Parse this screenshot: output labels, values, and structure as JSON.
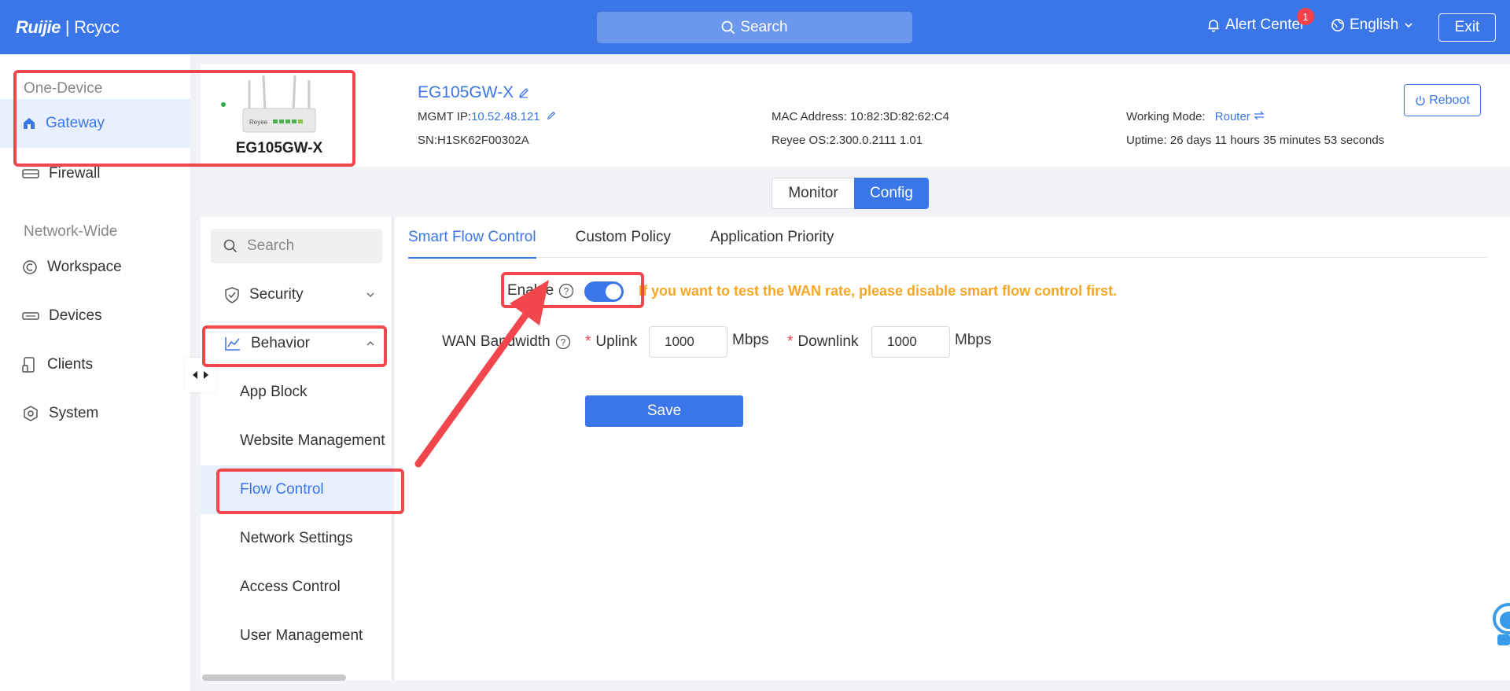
{
  "topbar": {
    "logo_a": "Ruijie",
    "logo_sep": "|",
    "logo_b": "Rcycc",
    "search_label": "Search",
    "alert_label": "Alert Center",
    "alert_count": "1",
    "language": "English",
    "exit_label": "Exit",
    "brand_color": "#3a76e8"
  },
  "sidebar": {
    "one_device_heading": "One-Device",
    "network_wide_heading": "Network-Wide",
    "items": [
      {
        "label": "Gateway",
        "icon": "home-icon",
        "active": true
      },
      {
        "label": "Firewall",
        "icon": "firewall-icon"
      },
      {
        "label": "Workspace",
        "icon": "workspace-icon"
      },
      {
        "label": "Devices",
        "icon": "devices-icon"
      },
      {
        "label": "Clients",
        "icon": "clients-icon"
      },
      {
        "label": "System",
        "icon": "system-icon"
      }
    ]
  },
  "device": {
    "image_caption": "EG105GW-X",
    "image_brand": "Reyee",
    "name": "EG105GW-X",
    "mgmt_ip_label": "MGMT IP:",
    "mgmt_ip": "10.52.48.121",
    "sn": "SN:H1SK62F00302A",
    "mac": "MAC Address: 10:82:3D:82:62:C4",
    "os": "Reyee OS:2.300.0.2111 1.01",
    "working_mode_label": "Working Mode:",
    "working_mode": "Router",
    "uptime": "Uptime: 26 days 11 hours 35 minutes 53 seconds",
    "reboot_label": "Reboot"
  },
  "mode_switch": {
    "monitor": "Monitor",
    "config": "Config",
    "active": "Config"
  },
  "menu": {
    "search_placeholder": "Search",
    "items": [
      {
        "label": "Security",
        "level": "top",
        "expanded": false
      },
      {
        "label": "Behavior",
        "level": "top",
        "expanded": true
      },
      {
        "label": "App Block",
        "level": "sub"
      },
      {
        "label": "Website Management",
        "level": "sub"
      },
      {
        "label": "Flow Control",
        "level": "sub",
        "active": true
      },
      {
        "label": "Network Settings",
        "level": "sub"
      },
      {
        "label": "Access Control",
        "level": "sub"
      },
      {
        "label": "User Management",
        "level": "sub"
      }
    ]
  },
  "content": {
    "tabs": [
      "Smart Flow Control",
      "Custom Policy",
      "Application Priority"
    ],
    "active_tab": "Smart Flow Control",
    "enable_label": "Enable",
    "enabled": true,
    "warning": "If you want to test the WAN rate, please disable smart flow control first.",
    "bandwidth_label": "WAN Bandwidth",
    "uplink_label": "Uplink",
    "uplink_value": "1000",
    "downlink_label": "Downlink",
    "downlink_value": "1000",
    "unit": "Mbps",
    "save_label": "Save",
    "warning_color": "#f5a623",
    "annotation_color": "#f0464c"
  }
}
